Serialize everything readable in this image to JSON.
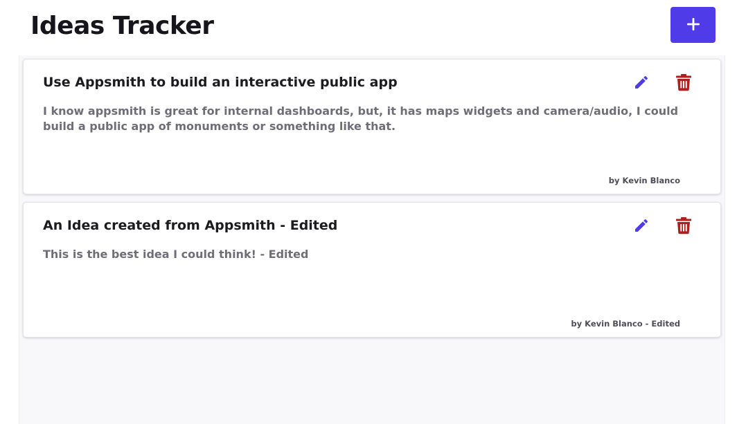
{
  "header": {
    "title": "Ideas Tracker",
    "add_icon": "plus-icon"
  },
  "colors": {
    "accent": "#4f3be8",
    "delete": "#b01e1e",
    "background": "#f8f8fa"
  },
  "ideas": [
    {
      "title": "Use Appsmith to build an interactive public app",
      "description": "I know appsmith is great for internal dashboards, but, it has maps widgets and camera/audio, I could build a public app of monuments or something like that.",
      "author": "by Kevin Blanco",
      "edit_icon": "pencil-icon",
      "delete_icon": "trash-icon"
    },
    {
      "title": "An Idea created from Appsmith - Edited",
      "description": "This is the best idea I could think! - Edited",
      "author": "by Kevin Blanco - Edited",
      "edit_icon": "pencil-icon",
      "delete_icon": "trash-icon"
    }
  ]
}
